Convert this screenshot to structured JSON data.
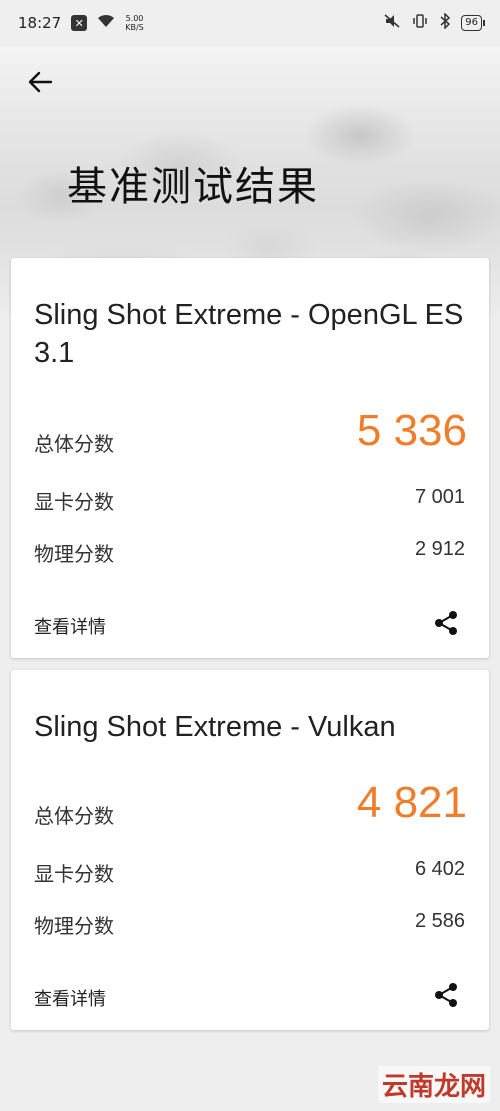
{
  "status_bar": {
    "time": "18:27",
    "speed_value": "5.00",
    "speed_unit": "KB/S",
    "battery": "96",
    "icons": [
      "notification-x-icon",
      "wifi-icon",
      "mute-vibrate-icon",
      "vibrate-icon",
      "bluetooth-icon",
      "battery-icon"
    ]
  },
  "header": {
    "title": "基准测试结果",
    "back_icon": "back-arrow-icon"
  },
  "results": [
    {
      "title": "Sling Shot Extreme - OpenGL ES 3.1",
      "overall_label": "总体分数",
      "overall_score": "5 336",
      "graphics_label": "显卡分数",
      "graphics_score": "7 001",
      "physics_label": "物理分数",
      "physics_score": "2 912",
      "details_label": "查看详情",
      "share_icon": "share-icon"
    },
    {
      "title": "Sling Shot Extreme - Vulkan",
      "overall_label": "总体分数",
      "overall_score": "4 821",
      "graphics_label": "显卡分数",
      "graphics_score": "6 402",
      "physics_label": "物理分数",
      "physics_score": "2 586",
      "details_label": "查看详情",
      "share_icon": "share-icon"
    }
  ],
  "watermark": "云南龙网",
  "colors": {
    "score_accent": "#f07d2a",
    "background": "#eeeeee",
    "card": "#ffffff"
  }
}
